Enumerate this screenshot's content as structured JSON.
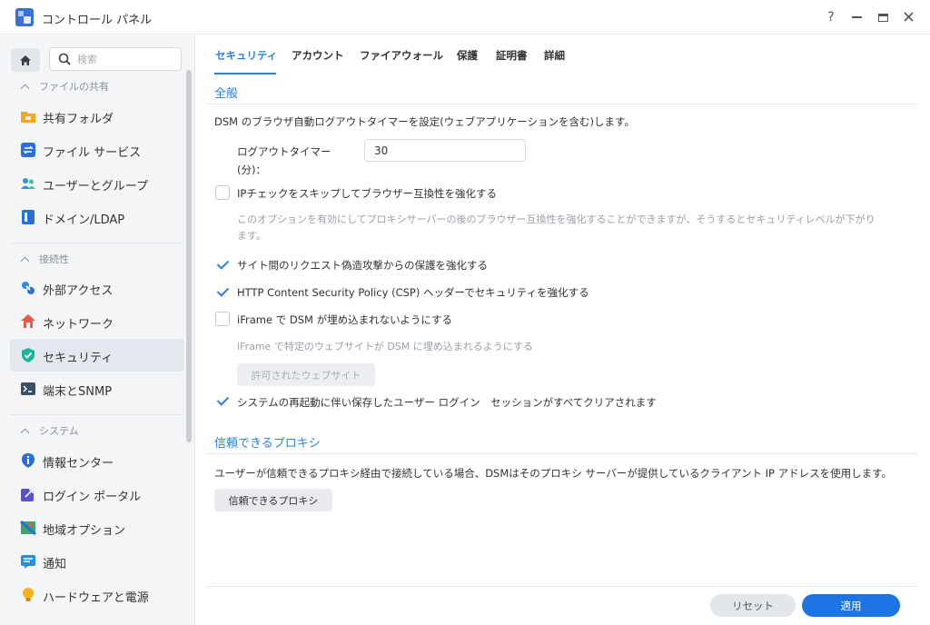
{
  "window": {
    "title": "コントロール パネル",
    "help": "?"
  },
  "sidebar": {
    "search_placeholder": "検索",
    "sections": [
      {
        "label": "ファイルの共有",
        "items": [
          {
            "label": "共有フォルダ",
            "icon": "folder-icon"
          },
          {
            "label": "ファイル サービス",
            "icon": "file-services-icon"
          },
          {
            "label": "ユーザーとグループ",
            "icon": "users-icon"
          },
          {
            "label": "ドメイン/LDAP",
            "icon": "domain-icon"
          }
        ]
      },
      {
        "label": "接続性",
        "items": [
          {
            "label": "外部アクセス",
            "icon": "external-access-icon"
          },
          {
            "label": "ネットワーク",
            "icon": "network-icon"
          },
          {
            "label": "セキュリティ",
            "icon": "shield-icon",
            "active": true
          },
          {
            "label": "端末とSNMP",
            "icon": "terminal-icon"
          }
        ]
      },
      {
        "label": "システム",
        "items": [
          {
            "label": "情報センター",
            "icon": "info-icon"
          },
          {
            "label": "ログイン ポータル",
            "icon": "login-portal-icon"
          },
          {
            "label": "地域オプション",
            "icon": "map-icon"
          },
          {
            "label": "通知",
            "icon": "notification-icon"
          },
          {
            "label": "ハードウェアと電源",
            "icon": "bulb-icon"
          }
        ]
      }
    ]
  },
  "tabs": [
    "セキュリティ",
    "アカウント",
    "ファイアウォール",
    "保護",
    "証明書",
    "詳細"
  ],
  "general": {
    "title": "全般",
    "description": "DSM のブラウザ自動ログアウトタイマーを設定(ウェブアプリケーションを含む)します。",
    "timer_label_1": "ログアウトタイマー",
    "timer_label_2": "(分)：",
    "timer_value": "30",
    "options": [
      {
        "label": "IPチェックをスキップしてブラウザー互換性を強化する",
        "checked": false
      },
      {
        "label": "サイト間のリクエスト偽造攻撃からの保護を強化する",
        "checked": true
      },
      {
        "label": "HTTP Content Security Policy (CSP) ヘッダーでセキュリティを強化する",
        "checked": true
      },
      {
        "label": "iFrame で DSM が埋め込まれないようにする",
        "checked": false
      },
      {
        "label": "システムの再起動に伴い保存したユーザー ログイン　セッションがすべてクリアされます",
        "checked": true
      }
    ],
    "ip_hint_1": "このオプションを有効にしてプロキシサーバーの後のブラウザー互換性を強化することができますが、そうするとセキュリティレベルが下がり",
    "ip_hint_2": "ます。",
    "iframe_hint": "iFrame で特定のウェブサイトが DSM に埋め込まれるようにする",
    "allowed_sites_button": "許可されたウェブサイト"
  },
  "proxy": {
    "title": "信頼できるプロキシ",
    "description": "ユーザーが信頼できるプロキシ経由で接続している場合、DSMはそのプロキシ サーバーが提供しているクライアント IP アドレスを使用します。",
    "button": "信頼できるプロキシ"
  },
  "footer": {
    "reset": "リセット",
    "apply": "適用"
  },
  "colors": {
    "accent": "#2f7fd9",
    "apply_button": "#1d74e5"
  }
}
